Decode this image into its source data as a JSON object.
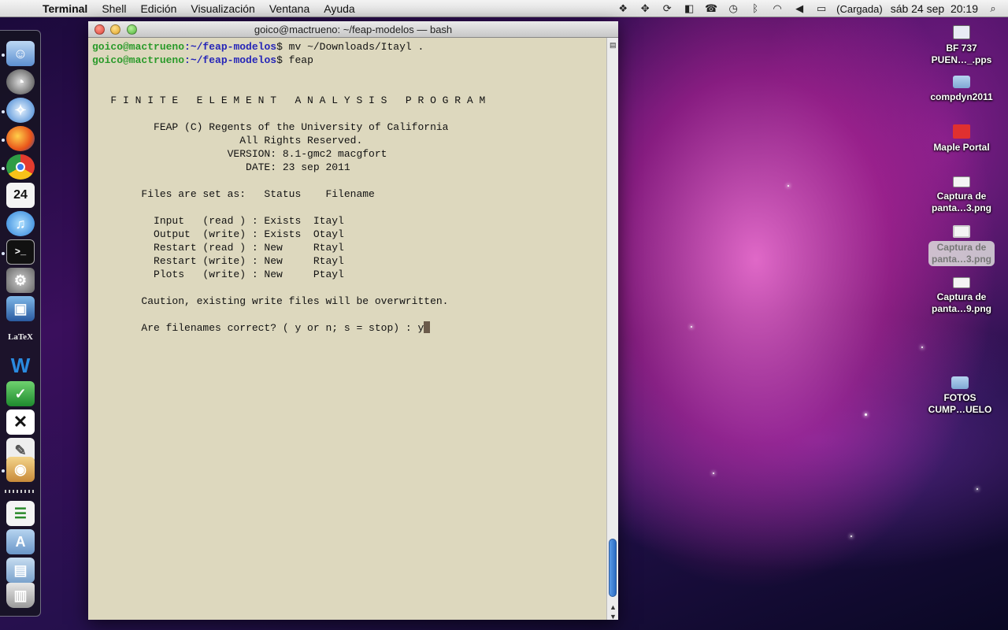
{
  "menubar": {
    "app_name": "Terminal",
    "menus": [
      "Shell",
      "Edición",
      "Visualización",
      "Ventana",
      "Ayuda"
    ],
    "battery_label": "(Cargada)",
    "clock": "sáb 24 sep  20:19"
  },
  "window": {
    "title": "goico@mactrueno: ~/feap-modelos — bash"
  },
  "terminal": {
    "prompt_user": "goico@mactrueno",
    "prompt_path": ":~/feap-modelos",
    "cmd1": "$ mv ~/Downloads/Itayl .",
    "cmd2": "$ feap",
    "banner": "   F I N I T E   E L E M E N T   A N A L Y S I S   P R O G R A M",
    "copyright": "          FEAP (C) Regents of the University of California",
    "rights": "                        All Rights Reserved.",
    "version": "                      VERSION: 8.1-gmc2 macgfort",
    "date": "                         DATE: 23 sep 2011",
    "files_header": "        Files are set as:   Status    Filename",
    "file_input": "          Input   (read ) : Exists  Itayl",
    "file_output": "          Output  (write) : Exists  Otayl",
    "file_restart_read": "          Restart (read ) : New     Rtayl",
    "file_restart_write": "          Restart (write) : New     Rtayl",
    "file_plots": "          Plots   (write) : New     Ptayl",
    "caution": "        Caution, existing write files will be overwritten.",
    "question": "        Are filenames correct? ( y or n; s = stop) : y"
  },
  "desktop_icons": [
    {
      "name": "BF 737\nPUEN…_.pps"
    },
    {
      "name": "compdyn2011"
    },
    {
      "name": "Maple Portal"
    },
    {
      "name": "Captura de\npanta…3.png"
    },
    {
      "name": "Captura de\npanta…3.png"
    },
    {
      "name": "Captura de\npanta…9.png"
    },
    {
      "name": "FOTOS\nCUMP…UELO"
    }
  ],
  "dock": {
    "ical_day": "24",
    "latex_label": "LaTeX"
  },
  "colors": {
    "terminal_bg": "#ddd8be",
    "prompt_user": "#2a9a2a",
    "prompt_path": "#2525b8"
  }
}
